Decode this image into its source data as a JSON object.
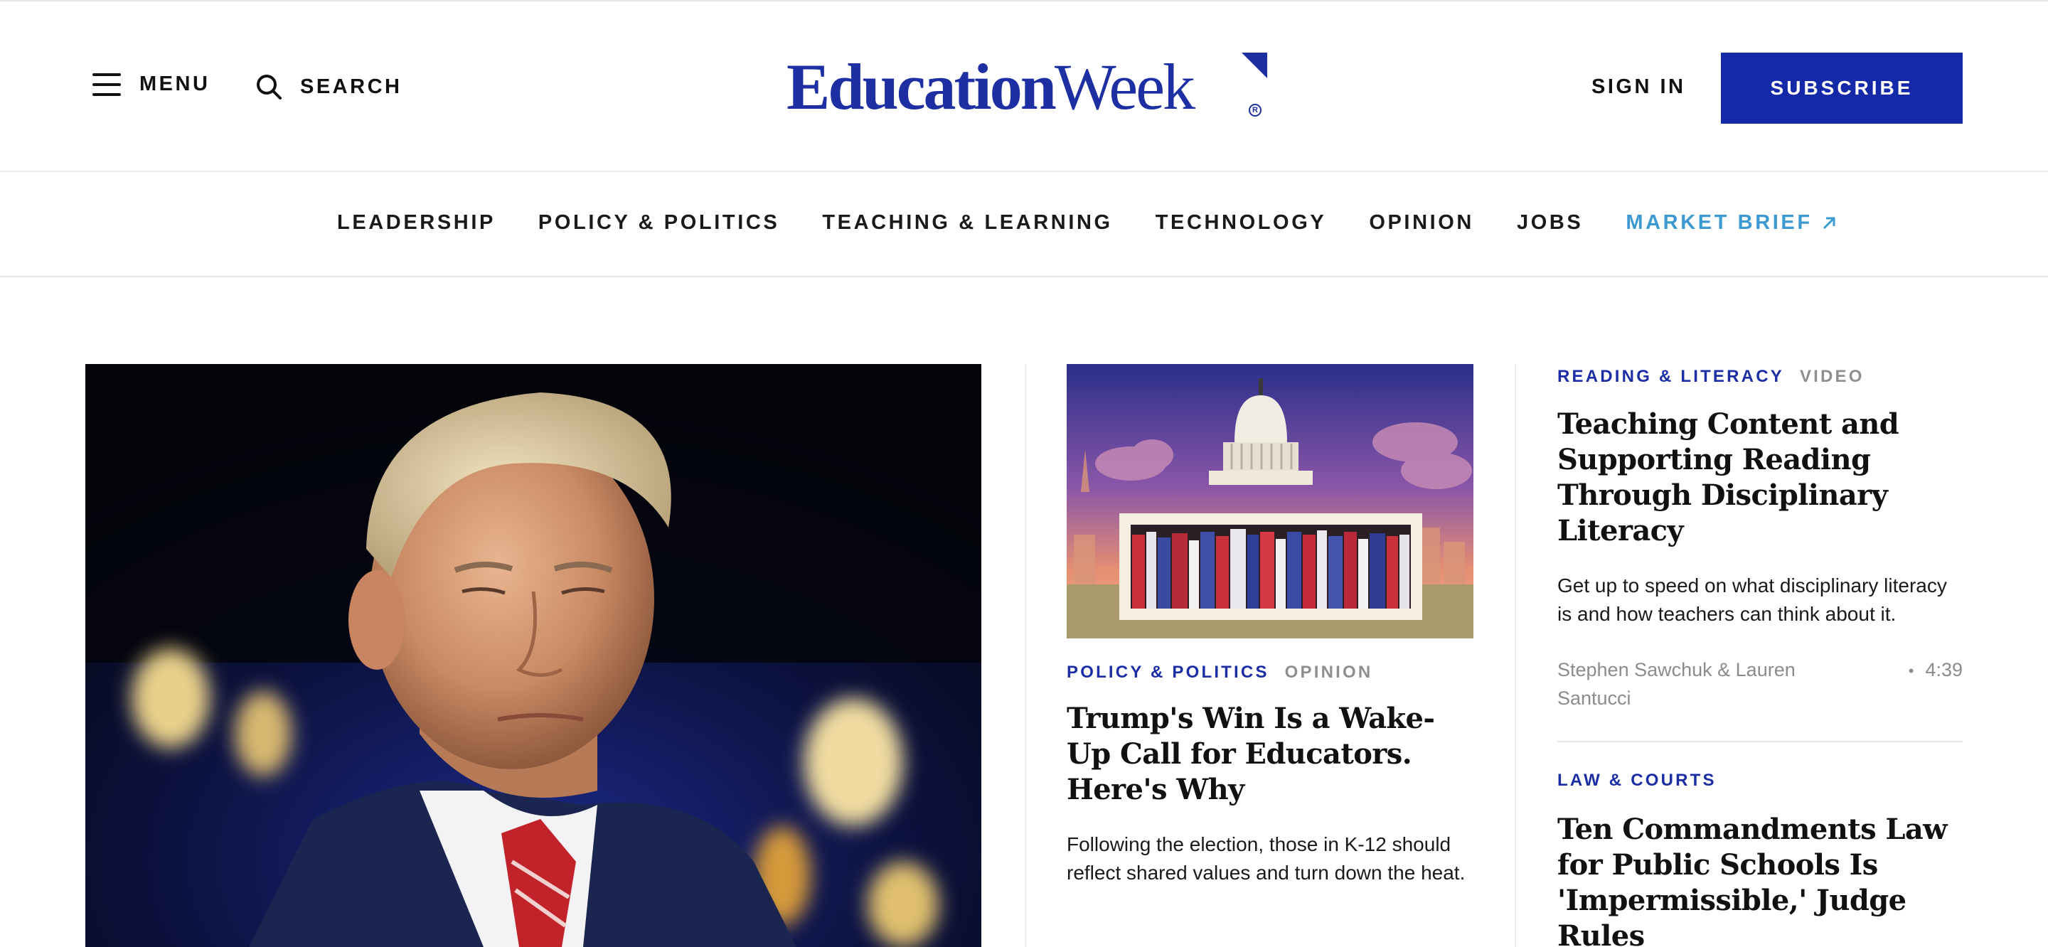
{
  "header": {
    "menu_label": "MENU",
    "search_label": "SEARCH",
    "logo_bold": "Education",
    "logo_light": "Week",
    "logo_registered": "R",
    "signin_label": "SIGN IN",
    "subscribe_label": "SUBSCRIBE"
  },
  "nav": {
    "items": [
      "LEADERSHIP",
      "POLICY & POLITICS",
      "TEACHING & LEARNING",
      "TECHNOLOGY",
      "OPINION",
      "JOBS"
    ],
    "market_brief": "MARKET BRIEF"
  },
  "middle_story": {
    "kicker": "POLICY & POLITICS",
    "kicker_type": "OPINION",
    "headline": "Trump's Win Is a Wake-Up Call for Educators. Here's Why",
    "dek": "Following the election, those in K-12 should reflect shared values and turn down the heat."
  },
  "right_story_1": {
    "kicker": "READING & LITERACY",
    "kicker_type": "VIDEO",
    "headline": "Teaching Content and Supporting Reading Through Disciplinary Literacy",
    "dek": "Get up to speed on what disciplinary literacy is and how teachers can think about it.",
    "byline": "Stephen Sawchuk & Lauren Santucci",
    "duration": "4:39"
  },
  "right_story_2": {
    "kicker": "LAW & COURTS",
    "headline": "Ten Commandments Law for Public Schools Is 'Impermissible,' Judge Rules"
  },
  "colors": {
    "brand_blue": "#1429a8",
    "market_brief": "#3d9ad1",
    "kicker_blue": "#1b2ea6",
    "muted_gray": "#8f8f8f"
  },
  "icons": {
    "menu": "hamburger-icon",
    "search": "magnifier-icon",
    "market_brief": "external-arrow-icon",
    "duration_separator": "dot"
  }
}
